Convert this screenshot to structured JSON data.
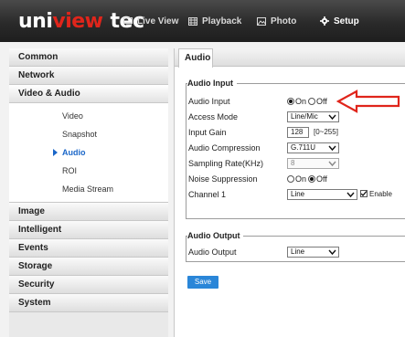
{
  "brand": {
    "part1": "uni",
    "part2": "view",
    "part3": "tec"
  },
  "nav": [
    {
      "label": "Live View",
      "icon": "monitor-icon"
    },
    {
      "label": "Playback",
      "icon": "film-icon"
    },
    {
      "label": "Photo",
      "icon": "image-icon"
    },
    {
      "label": "Setup",
      "icon": "gear-icon"
    }
  ],
  "sidebar": {
    "categories": [
      "Common",
      "Network",
      "Video & Audio",
      "Image",
      "Intelligent",
      "Events",
      "Storage",
      "Security",
      "System"
    ],
    "video_audio_items": [
      "Video",
      "Snapshot",
      "Audio",
      "ROI",
      "Media Stream"
    ],
    "active_item": "Audio"
  },
  "tab": "Audio",
  "audio_input": {
    "title": "Audio Input",
    "audio_input_label": "Audio Input",
    "on_label": "On",
    "off_label": "Off",
    "audio_input_value": "On",
    "access_mode_label": "Access Mode",
    "access_mode_value": "Line/Mic",
    "input_gain_label": "Input Gain",
    "input_gain_value": "128",
    "input_gain_range": "[0~255]",
    "compression_label": "Audio Compression",
    "compression_value": "G.711U",
    "sampling_label": "Sampling Rate(KHz)",
    "sampling_value": "8",
    "noise_label": "Noise Suppression",
    "noise_value": "Off",
    "channel_label": "Channel 1",
    "channel_value": "Line",
    "enable_label": "Enable",
    "enable_checked": true
  },
  "audio_output": {
    "title": "Audio Output",
    "output_label": "Audio Output",
    "output_value": "Line"
  },
  "save_label": "Save",
  "colors": {
    "accent_red": "#e0251b",
    "save_blue": "#2a86d8",
    "active_blue": "#1a66c8"
  }
}
